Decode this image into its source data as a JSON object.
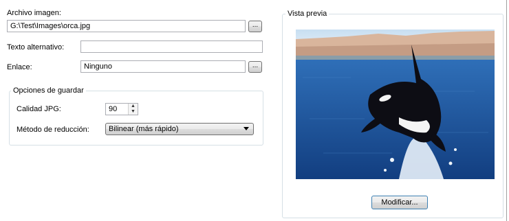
{
  "image_file": {
    "label": "Archivo imagen:",
    "value": "G:\\Test\\Images\\orca.jpg",
    "browse_label": "..."
  },
  "alt_text": {
    "label": "Texto alternativo:",
    "value": ""
  },
  "link": {
    "label": "Enlace:",
    "value": "Ninguno",
    "browse_label": "..."
  },
  "save_options": {
    "title": "Opciones de guardar",
    "jpg_quality_label": "Calidad JPG:",
    "jpg_quality_value": "90",
    "reduction_label": "Método de reducción:",
    "reduction_value": "Bilinear (más rápido)"
  },
  "preview": {
    "title": "Vista previa",
    "modify_label": "Modificar...",
    "image_subject": "orca jumping out of the sea"
  },
  "colors": {
    "sea": "#1c4f99",
    "sky": "#d2e6f5",
    "shore": "#d6b197"
  }
}
